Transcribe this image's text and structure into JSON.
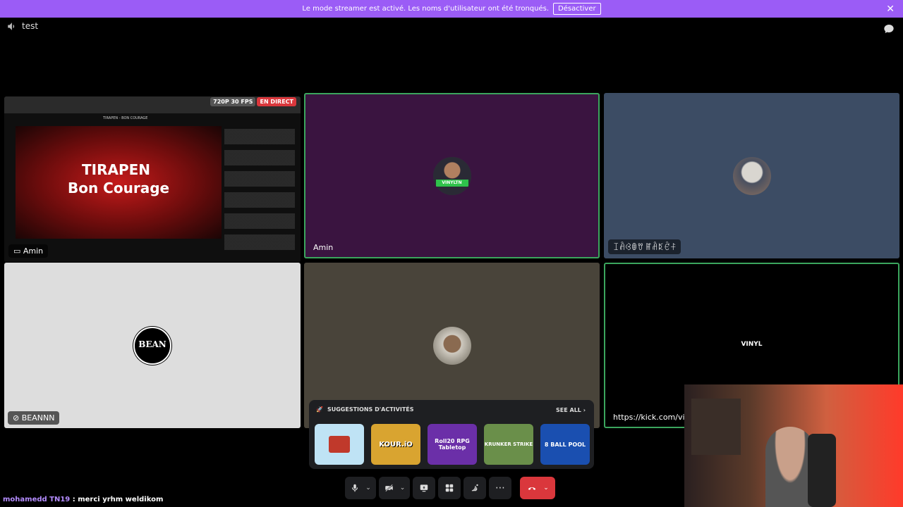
{
  "banner": {
    "message": "Le mode streamer est activé. Les noms d'utilisateur ont été tronqués.",
    "button_label": "Désactiver"
  },
  "channel": {
    "name": "test"
  },
  "tiles": [
    {
      "name": "Amin",
      "screen_title": "TIRAPEN - BON COURAGE",
      "video_line1": "TIRAPEN",
      "video_line2": "Bon Courage",
      "quality": "720P 30 FPS",
      "live": "EN DIRECT"
    },
    {
      "name": "Amin",
      "avatar_label": "VINYLTN"
    },
    {
      "name": "ꀤꋫꃳꂦꀎ ꂵꋫꌅꑾꊰ"
    },
    {
      "name": "BEANNN",
      "avatar_text": "BEAN"
    },
    {
      "name": ""
    },
    {
      "name": "https://kick.com/vinyltn",
      "avatar_text": "VINYL"
    }
  ],
  "activities": {
    "title": "SUGGESTIONS D'ACTIVITÉS",
    "see_all": "SEE ALL",
    "items": [
      {
        "label": "",
        "color": "#bfe3f5"
      },
      {
        "label": "KOUR.iO",
        "color": "#d9a430"
      },
      {
        "label": "Roll20 RPG Tabletop",
        "color": "#6b2fa8"
      },
      {
        "label": "KRUNKER STRIKE",
        "color": "#6a8f4a"
      },
      {
        "label": "8 BALL POOL",
        "color": "#1a4fb0"
      }
    ]
  },
  "chat": {
    "user": "mohamedd TN19",
    "separator": ":",
    "message": "merci yrhm weldikom"
  },
  "colors": {
    "banner": "#9b5cf6",
    "speaking_border": "#3ba55d",
    "hangup": "#da373c"
  }
}
